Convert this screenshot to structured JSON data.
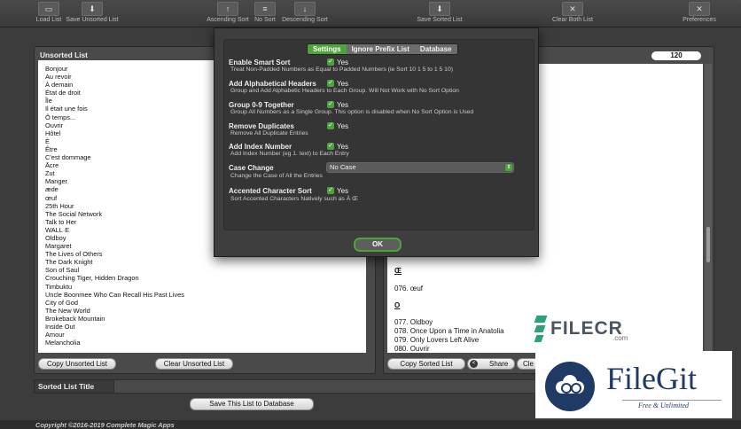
{
  "toolbar": {
    "load_list": "Load List",
    "save_unsorted": "Save Unsorted List",
    "ascending": "Ascending Sort",
    "no_sort": "No Sort",
    "descending": "Descending Sort",
    "save_sorted": "Save Sorted List",
    "clear_both": "Clear Both List",
    "preferences": "Preferences"
  },
  "unsorted": {
    "header": "Unsorted List",
    "items": [
      "Bonjour",
      "Au revoir",
      "À demain",
      "État de droit",
      "Île",
      "Il était une fois",
      "Ô temps...",
      "Ouvrir",
      "Hôtel",
      "È",
      "Être",
      "C'est dommage",
      "Ācre",
      "Zut",
      "Manger",
      "æde",
      "œuf",
      "25th Hour",
      "The Social Network",
      "Talk to Her",
      "WALL·E",
      "Oldboy",
      "Margaret",
      "The Lives of Others",
      "The Dark Knight",
      "Son of Saul",
      "Crouching Tiger, Hidden Dragon",
      "Timbuktu",
      "Uncle Boonmee Who Can Recall His Past Lives",
      "City of God",
      "The New World",
      "Brokeback Mountain",
      "Inside Out",
      "Amour",
      "Melancholia"
    ],
    "copy_label": "Copy Unsorted List",
    "clear_label": "Clear Unsorted List"
  },
  "sorted": {
    "count": "120",
    "header_oe": "Œ",
    "oe_item": "076. œuf",
    "header_o": "O",
    "o_items": [
      "077. Oldboy",
      "078. Once Upon a Time in Anatolia",
      "079. Only Lovers Left Alive",
      "080. Ouvrir"
    ],
    "copy_label": "Copy Sorted List",
    "share_label": "Share",
    "cl_label": "Cle"
  },
  "bottom": {
    "title_label": "Sorted List Title",
    "save_db_label": "Save This List to Database",
    "copyright": "Copyright ©2016-2019 Complete Magic Apps"
  },
  "modal": {
    "tabs": [
      "Settings",
      "Ignore Prefix List",
      "Database"
    ],
    "options": [
      {
        "title": "Enable Smart Sort",
        "value": "Yes",
        "desc": "Treat Non-Padded Numbers as Equal to Padded Numbers (ie Sort 10 1 5 to 1 5 10)"
      },
      {
        "title": "Add Alphabetical Headers",
        "value": "Yes",
        "desc": "Group and Add Alphabetic Headers to Each Group. Will Not Work with No Sort Option"
      },
      {
        "title": "Group 0-9 Together",
        "value": "Yes",
        "desc": "Group All Numbers as a Single Group. This option is disabled when No Sort Option is Used"
      },
      {
        "title": "Remove Duplicates",
        "value": "Yes",
        "desc": "Remove All Duplicate Entries"
      },
      {
        "title": "Add Index Number",
        "value": "Yes",
        "desc": "Add Index Number (eg 1. text) to Each Entry"
      },
      {
        "title": "Case Change",
        "value": "No Case",
        "desc": "Change the Case of All the Entries"
      },
      {
        "title": "Accented Character Sort",
        "value": "Yes",
        "desc": "Sort Accented Characters Natively such as À Œ"
      }
    ],
    "ok_label": "OK"
  },
  "watermark": {
    "filecr": "FILECR",
    "filecr_sub": ".com",
    "filegit": "FileGit",
    "filegit_sub": "Free & Unlimited"
  },
  "colors": {
    "accent": "#4da53a",
    "panel": "#4a4a4a",
    "bg": "#3c3c3c"
  }
}
